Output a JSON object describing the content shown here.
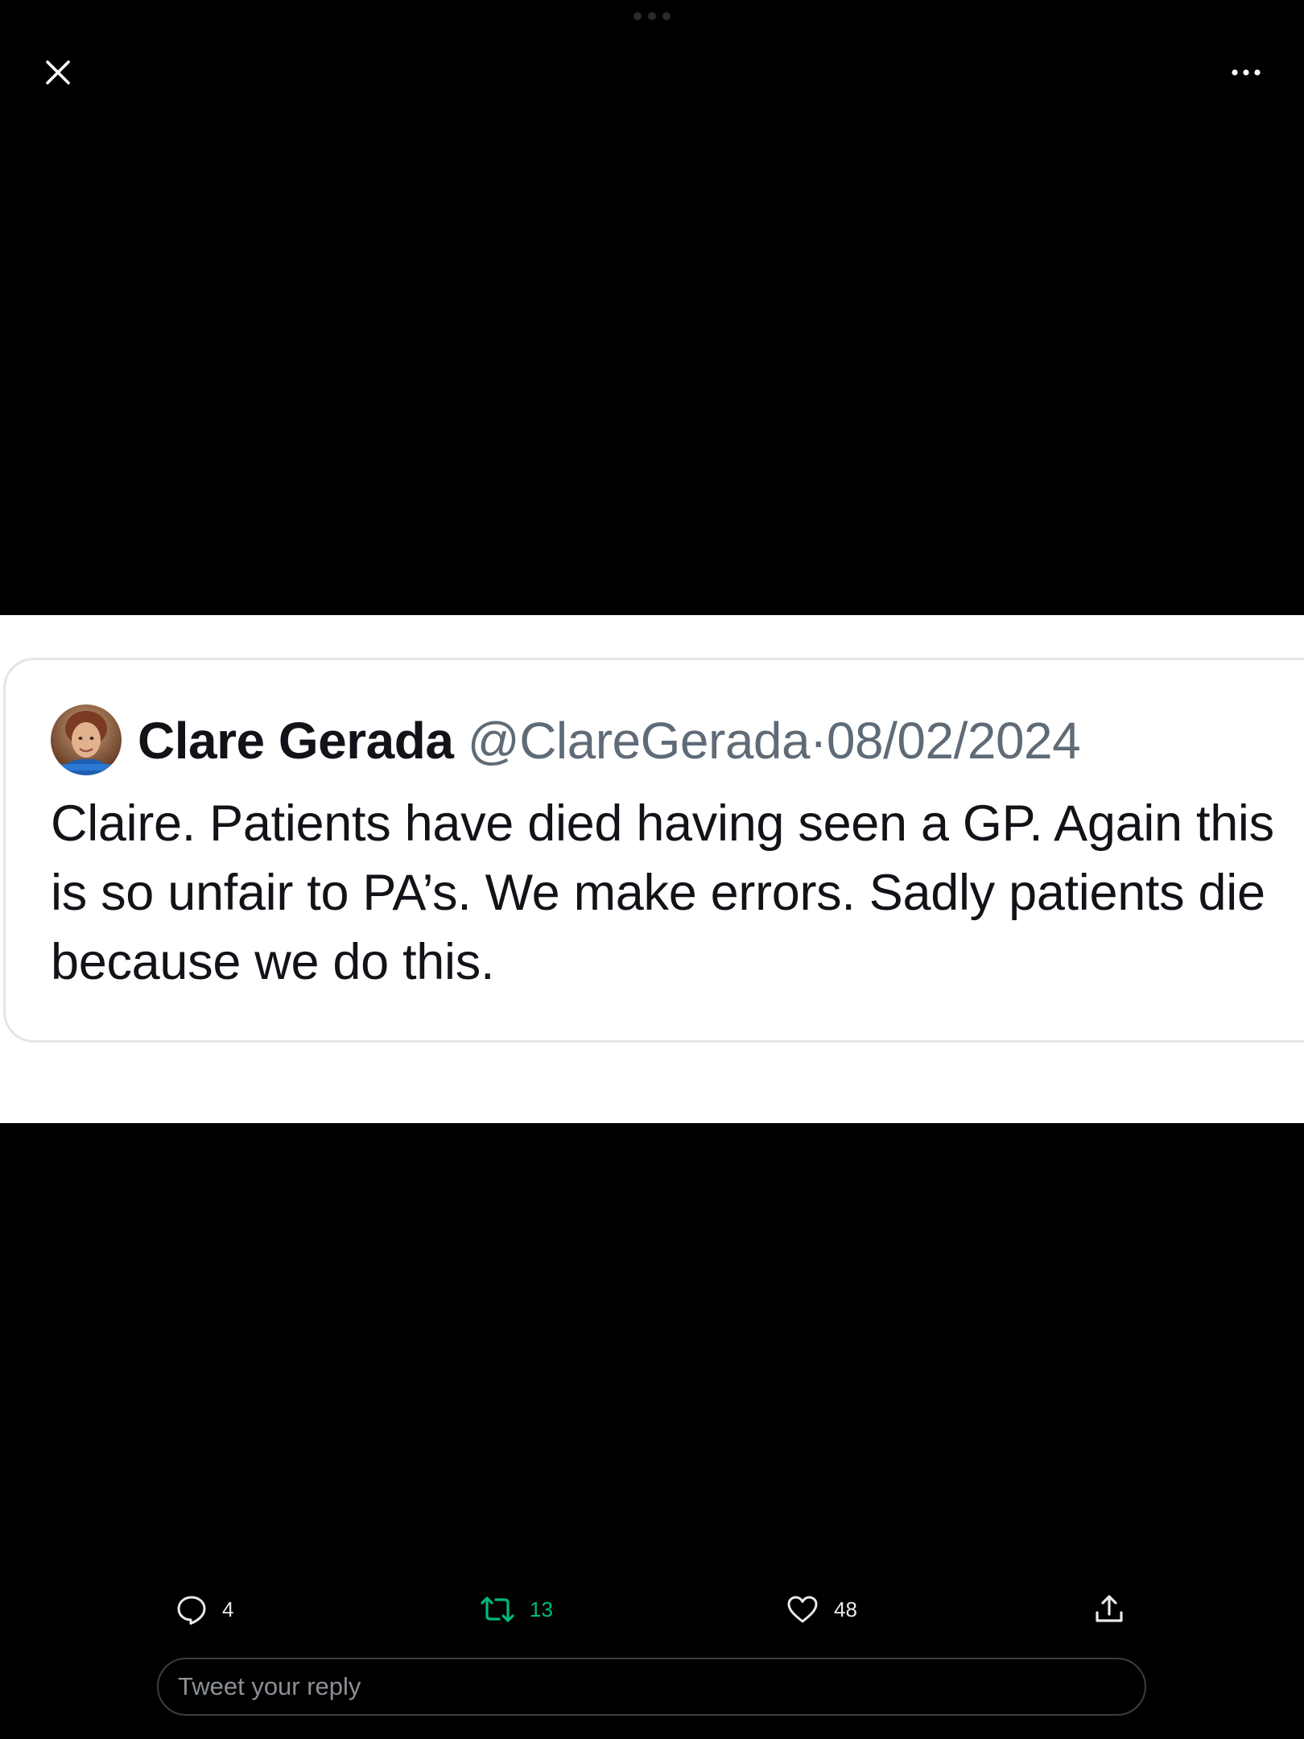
{
  "viewer": {
    "close_icon": "close-icon",
    "more_icon": "more-horizontal-icon"
  },
  "quoted_tweet": {
    "author_name": "Clare Gerada",
    "handle": "@ClareGerada",
    "separator": "·",
    "date": "08/02/2024",
    "text": "Claire. Patients have died having seen a GP. Again this is so unfair to PA’s. We make errors. Sadly patients die because we do this."
  },
  "actions": {
    "replies": "4",
    "retweets": "13",
    "likes": "48",
    "retweet_color": "#00ba7c"
  },
  "reply": {
    "placeholder": "Tweet your reply"
  }
}
